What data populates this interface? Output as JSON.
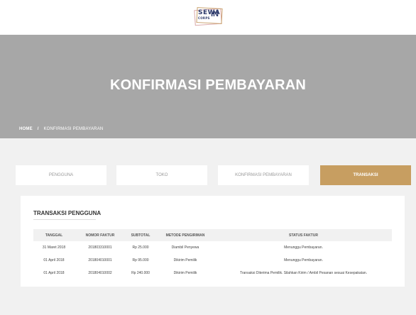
{
  "logo": {
    "line1": "SEWA",
    "line2": "CORPS",
    "suffix": "IN"
  },
  "hero": {
    "title": "KONFIRMASI PEMBAYARAN",
    "breadcrumb": {
      "home": "HOME",
      "separator": "/",
      "current": "KONFIRMASI PEMBAYARAN"
    }
  },
  "tabs": [
    {
      "label": "PENGGUNA",
      "active": false
    },
    {
      "label": "TOKO",
      "active": false
    },
    {
      "label": "KONFIRMASI PEMBAYARAN",
      "active": false
    },
    {
      "label": "TRANSAKSI",
      "active": true
    }
  ],
  "section": {
    "title": "TRANSAKSI PENGGUNA",
    "columns": [
      "TANGGAL",
      "NOMOR FAKTUR",
      "SUBTOTAL",
      "METODE PENGIRIMAN",
      "STATUS FAKTUR"
    ],
    "rows": [
      [
        "31 Maret 2018",
        "201803310001",
        "Rp 25.000",
        "Diambil Penyewa",
        "Menunggu Pembayaran."
      ],
      [
        "01 April 2018",
        "201804010001",
        "Rp 95.000",
        "Dikirim Pemilik",
        "Menunggu Pembayaran."
      ],
      [
        "01 April 2018",
        "201804010002",
        "Rp 240.000",
        "Dikirim Pemilik",
        "Transaksi Diterima Pemilik. Silahkan Kirim / Ambil Pesanan sesuai Kesepakatan."
      ]
    ]
  },
  "colors": {
    "accent": "#c79e61",
    "hero_bg": "#a7a7a7",
    "page_bg": "#f1f1f1"
  }
}
